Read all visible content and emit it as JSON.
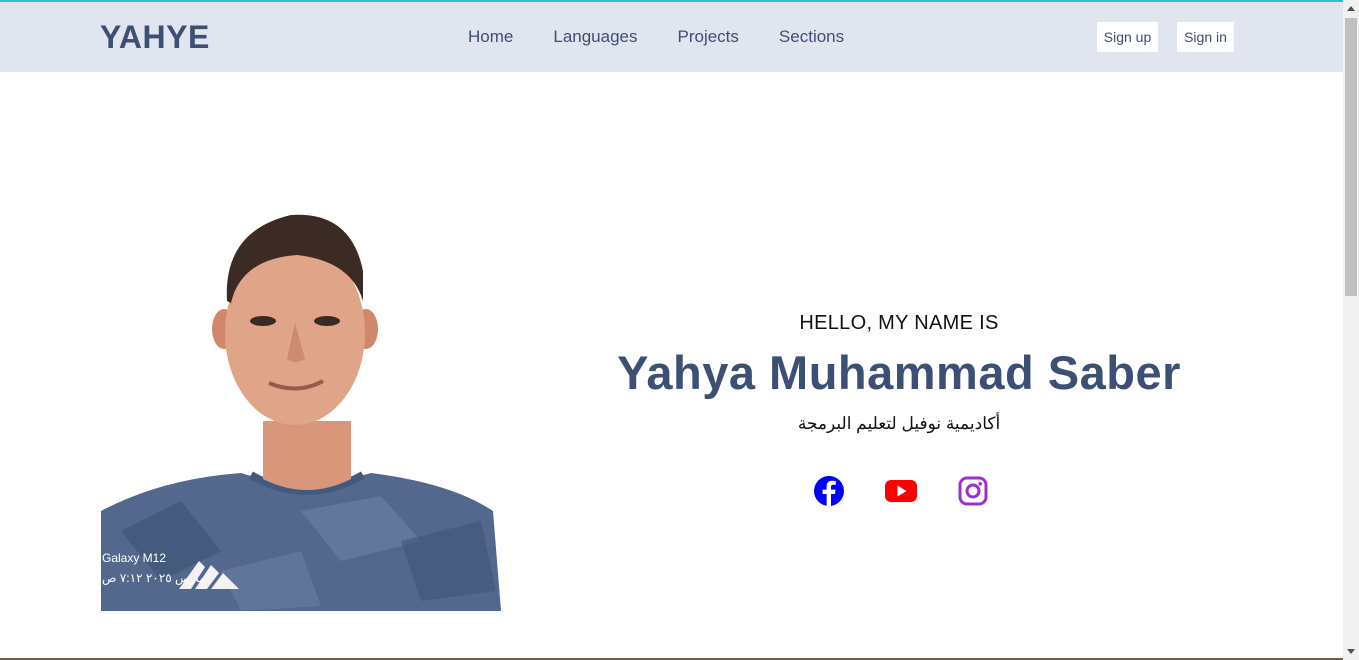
{
  "navbar": {
    "logo": "YAHYE",
    "links": [
      "Home",
      "Languages",
      "Projects",
      "Sections"
    ],
    "signup_label": "Sign up",
    "signin_label": "Sign in"
  },
  "hero": {
    "greeting": "HELLO, MY NAME IS",
    "name": "Yahya Muhammad Saber",
    "subtitle": "أكاديمية نوفيل لتعليم البرمجة",
    "photo_caption_line1": "Galaxy M12",
    "photo_caption_line2": "مارس ٢٠٢٥ ٧:١٢ ص"
  },
  "socials": [
    {
      "icon": "facebook-icon",
      "color": "#0000ff"
    },
    {
      "icon": "youtube-icon",
      "color": "#ff0000"
    },
    {
      "icon": "instagram-icon",
      "color": "#9b30d0"
    }
  ],
  "colors": {
    "accent": "#3d4f73",
    "navbar_bg": "#e1e5f0"
  }
}
